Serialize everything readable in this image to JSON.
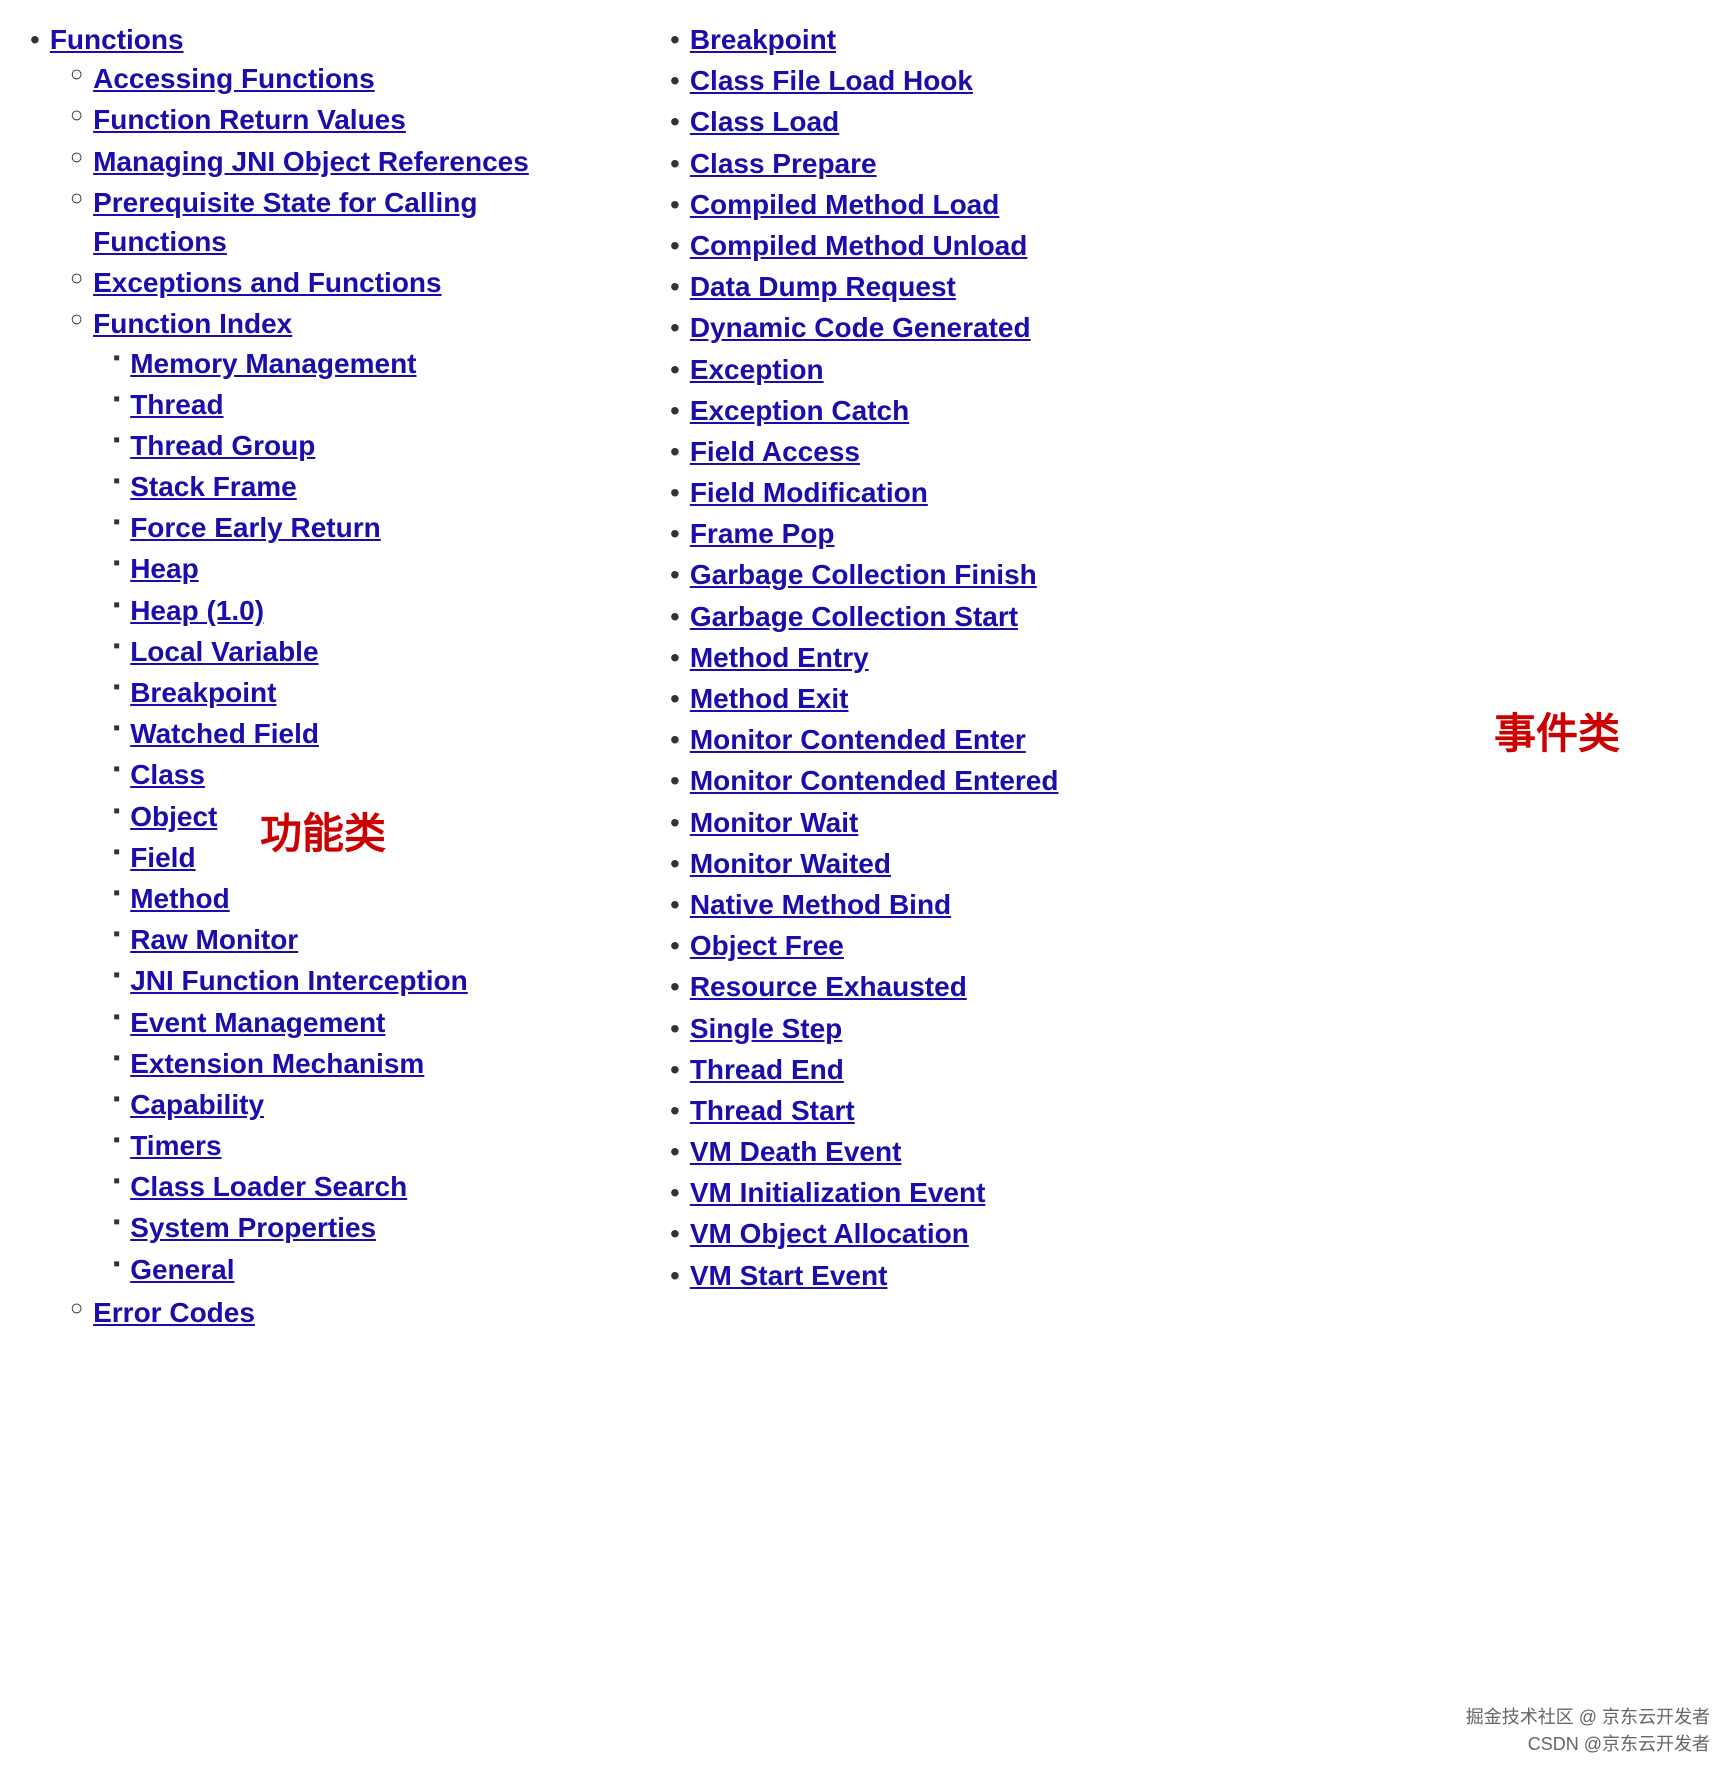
{
  "left": {
    "top_item": {
      "label": "Functions",
      "href": "#functions"
    },
    "sub_items": [
      {
        "label": "Accessing Functions",
        "href": "#accessing-functions",
        "level": "2"
      },
      {
        "label": "Function Return Values",
        "href": "#function-return-values",
        "level": "2"
      },
      {
        "label": "Managing JNI Object References",
        "href": "#managing-jni-object-references",
        "level": "2"
      },
      {
        "label": "Prerequisite State for Calling Functions",
        "href": "#prerequisite-state-for-calling-functions",
        "level": "2"
      },
      {
        "label": "Exceptions and Functions",
        "href": "#exceptions-and-functions",
        "level": "2"
      },
      {
        "label": "Function Index",
        "href": "#function-index",
        "level": "2",
        "children": [
          {
            "label": "Memory Management",
            "href": "#memory-management"
          },
          {
            "label": "Thread",
            "href": "#thread"
          },
          {
            "label": "Thread Group",
            "href": "#thread-group"
          },
          {
            "label": "Stack Frame",
            "href": "#stack-frame"
          },
          {
            "label": "Force Early Return",
            "href": "#force-early-return"
          },
          {
            "label": "Heap",
            "href": "#heap"
          },
          {
            "label": "Heap (1.0)",
            "href": "#heap-10"
          },
          {
            "label": "Local Variable",
            "href": "#local-variable"
          },
          {
            "label": "Breakpoint",
            "href": "#breakpoint"
          },
          {
            "label": "Watched Field",
            "href": "#watched-field"
          },
          {
            "label": "Class",
            "href": "#class"
          },
          {
            "label": "Object",
            "href": "#object"
          },
          {
            "label": "Field",
            "href": "#field"
          },
          {
            "label": "Method",
            "href": "#method"
          },
          {
            "label": "Raw Monitor",
            "href": "#raw-monitor"
          },
          {
            "label": "JNI Function Interception",
            "href": "#jni-function-interception"
          },
          {
            "label": "Event Management",
            "href": "#event-management"
          },
          {
            "label": "Extension Mechanism",
            "href": "#extension-mechanism"
          },
          {
            "label": "Capability",
            "href": "#capability"
          },
          {
            "label": "Timers",
            "href": "#timers"
          },
          {
            "label": "Class Loader Search",
            "href": "#class-loader-search"
          },
          {
            "label": "System Properties",
            "href": "#system-properties"
          },
          {
            "label": "General",
            "href": "#general"
          }
        ]
      },
      {
        "label": "Error Codes",
        "href": "#error-codes",
        "level": "2"
      }
    ]
  },
  "right": {
    "items": [
      {
        "label": "Breakpoint",
        "href": "#breakpoint"
      },
      {
        "label": "Class File Load Hook",
        "href": "#class-file-load-hook"
      },
      {
        "label": "Class Load",
        "href": "#class-load"
      },
      {
        "label": "Class Prepare",
        "href": "#class-prepare"
      },
      {
        "label": "Compiled Method Load",
        "href": "#compiled-method-load"
      },
      {
        "label": "Compiled Method Unload",
        "href": "#compiled-method-unload"
      },
      {
        "label": "Data Dump Request",
        "href": "#data-dump-request"
      },
      {
        "label": "Dynamic Code Generated",
        "href": "#dynamic-code-generated"
      },
      {
        "label": "Exception",
        "href": "#exception"
      },
      {
        "label": "Exception Catch",
        "href": "#exception-catch"
      },
      {
        "label": "Field Access",
        "href": "#field-access"
      },
      {
        "label": "Field Modification",
        "href": "#field-modification"
      },
      {
        "label": "Frame Pop",
        "href": "#frame-pop"
      },
      {
        "label": "Garbage Collection Finish",
        "href": "#garbage-collection-finish"
      },
      {
        "label": "Garbage Collection Start",
        "href": "#garbage-collection-start"
      },
      {
        "label": "Method Entry",
        "href": "#method-entry"
      },
      {
        "label": "Method Exit",
        "href": "#method-exit"
      },
      {
        "label": "Monitor Contended Enter",
        "href": "#monitor-contended-enter"
      },
      {
        "label": "Monitor Contended Entered",
        "href": "#monitor-contended-entered"
      },
      {
        "label": "Monitor Wait",
        "href": "#monitor-wait"
      },
      {
        "label": "Monitor Waited",
        "href": "#monitor-waited"
      },
      {
        "label": "Native Method Bind",
        "href": "#native-method-bind"
      },
      {
        "label": "Object Free",
        "href": "#object-free"
      },
      {
        "label": "Resource Exhausted",
        "href": "#resource-exhausted"
      },
      {
        "label": "Single Step",
        "href": "#single-step"
      },
      {
        "label": "Thread End",
        "href": "#thread-end"
      },
      {
        "label": "Thread Start",
        "href": "#thread-start"
      },
      {
        "label": "VM Death Event",
        "href": "#vm-death-event"
      },
      {
        "label": "VM Initialization Event",
        "href": "#vm-initialization-event"
      },
      {
        "label": "VM Object Allocation",
        "href": "#vm-object-allocation"
      },
      {
        "label": "VM Start Event",
        "href": "#vm-start-event"
      }
    ]
  },
  "annotations": {
    "left_label": "功能类",
    "right_label": "事件类"
  },
  "watermark": {
    "line1": "掘金技术社区 @ 京东云开发者",
    "line2": "CSDN @京东云开发者"
  }
}
